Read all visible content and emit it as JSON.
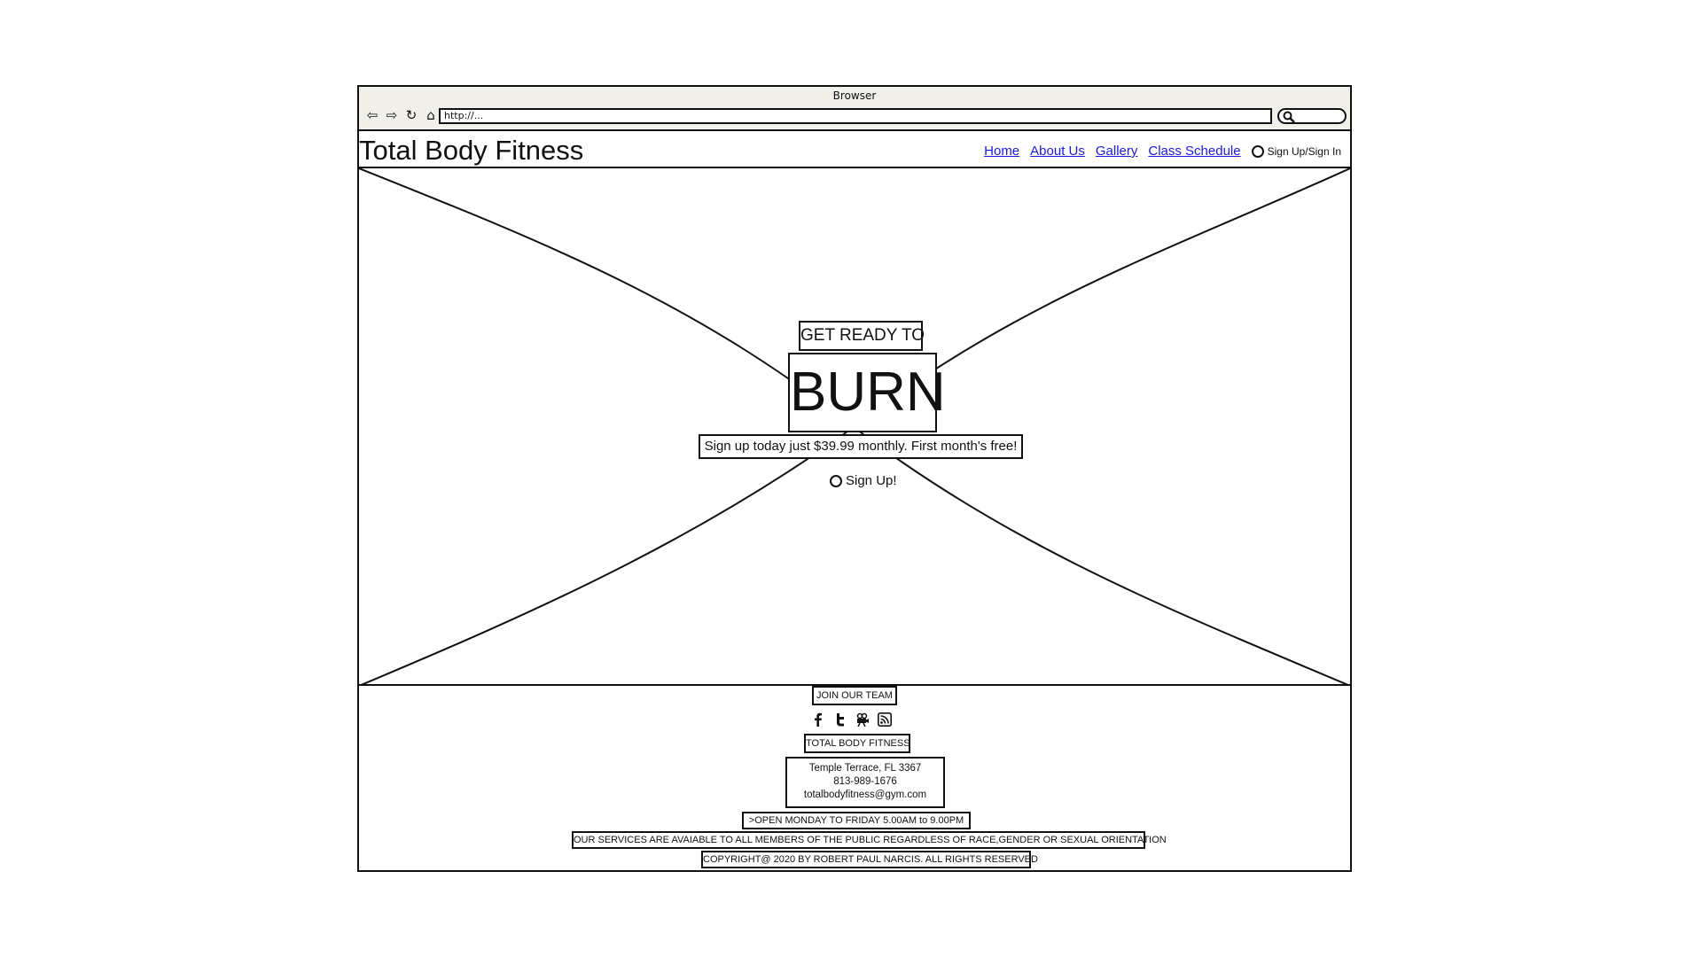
{
  "browser": {
    "window_title": "Browser",
    "url": "http://..."
  },
  "header": {
    "site_title": "Total Body Fitness",
    "nav": [
      {
        "label": "Home"
      },
      {
        "label": "About Us"
      },
      {
        "label": "Gallery"
      },
      {
        "label": "Class Schedule"
      }
    ],
    "signin_label": "Sign Up/Sign In"
  },
  "hero": {
    "kicker": "GET READY TO",
    "headline": "BURN",
    "promo": "Sign up today just $39.99 monthly. First month's free!",
    "signup_label": "Sign Up!"
  },
  "footer": {
    "join_label": "JOIN OUR TEAM",
    "socials": [
      "facebook-icon",
      "twitter-icon",
      "video-icon",
      "rss-icon"
    ],
    "company": "TOTAL BODY FITNESS",
    "address_line": "Temple Terrace, FL 3367",
    "phone": "813-989-1676",
    "email": "totalbodyfitness@gym.com",
    "hours": ">OPEN MONDAY TO FRIDAY 5.00AM to 9.00PM",
    "services": "OUR SERVICES ARE AVAIABLE TO ALL MEMBERS OF THE PUBLIC REGARDLESS OF RACE,GENDER OR SEXUAL ORIENTATION",
    "copyright": "COPYRIGHT@ 2020 BY ROBERT PAUL NARCIS. ALL RIGHTS RESERVED"
  }
}
